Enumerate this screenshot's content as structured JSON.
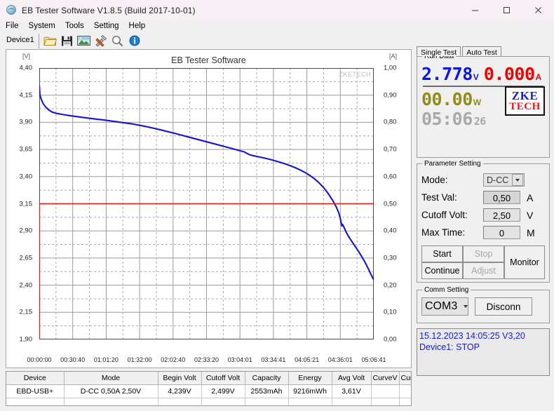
{
  "window": {
    "title": "EB Tester Software V1.8.5 (Build 2017-10-01)",
    "minimize": "–",
    "maximize": "□",
    "close": "✕"
  },
  "menu": [
    "File",
    "System",
    "Tools",
    "Setting",
    "Help"
  ],
  "toolbar": {
    "device_tab": "Device1",
    "icons": [
      "open-folder-icon",
      "save-disk-icon",
      "image-export-icon",
      "tools-icon",
      "zoom-search-icon",
      "info-icon"
    ]
  },
  "chart_data": {
    "type": "line",
    "title": "EB Tester Software",
    "watermark": "ZKETECH",
    "xlabel": "",
    "ylabel": "[V]",
    "y2label": "[A]",
    "grid": true,
    "legend": "none",
    "ylim": [
      1.9,
      4.4
    ],
    "y2lim": [
      0.0,
      1.0
    ],
    "yticks": [
      "4,40",
      "4,15",
      "3,90",
      "3,65",
      "3,40",
      "3,15",
      "2,90",
      "2,65",
      "2,40",
      "2,15",
      "1,90"
    ],
    "y2ticks": [
      "1,00",
      "0,90",
      "0,80",
      "0,70",
      "0,60",
      "0,50",
      "0,40",
      "0,30",
      "0,20",
      "0,10",
      "0,00"
    ],
    "xticks": [
      "00:00:00",
      "00:30:40",
      "01:01:20",
      "01:32:00",
      "02:02:40",
      "02:33:20",
      "03:04:01",
      "03:34:41",
      "04:05:21",
      "04:36:01",
      "05:06:41"
    ],
    "xlim_seconds": [
      0,
      18401
    ],
    "series": [
      {
        "name": "Voltage",
        "unit": "V",
        "color": "#1414d2",
        "axis": "left",
        "points": [
          [
            0,
            4.239
          ],
          [
            0.3,
            4.15
          ],
          [
            0.8,
            4.115
          ],
          [
            1.6,
            4.075
          ],
          [
            2.6,
            4.045
          ],
          [
            4.0,
            4.015
          ],
          [
            5.5,
            3.995
          ],
          [
            7.5,
            3.982
          ],
          [
            10.0,
            3.972
          ],
          [
            13.0,
            3.962
          ],
          [
            16.0,
            3.953
          ],
          [
            19.0,
            3.944
          ],
          [
            22.0,
            3.936
          ],
          [
            25.0,
            3.928
          ],
          [
            28.0,
            3.921
          ],
          [
            31.0,
            3.912
          ],
          [
            34.0,
            3.903
          ],
          [
            37.0,
            3.894
          ],
          [
            40.0,
            3.885
          ],
          [
            43.0,
            3.873
          ],
          [
            46.0,
            3.86
          ],
          [
            49.0,
            3.846
          ],
          [
            52.0,
            3.831
          ],
          [
            55.0,
            3.815
          ],
          [
            58.0,
            3.799
          ],
          [
            61.0,
            3.782
          ],
          [
            64.0,
            3.765
          ],
          [
            67.0,
            3.748
          ],
          [
            70.0,
            3.731
          ],
          [
            73.0,
            3.714
          ],
          [
            76.0,
            3.697
          ],
          [
            79.0,
            3.68
          ],
          [
            82.0,
            3.663
          ],
          [
            85.0,
            3.645
          ],
          [
            88.0,
            3.628
          ],
          [
            89.5,
            3.61
          ],
          [
            90.5,
            3.6
          ],
          [
            92.0,
            3.592
          ],
          [
            94.0,
            3.583
          ],
          [
            96.0,
            3.574
          ],
          [
            98.0,
            3.564
          ],
          [
            100.0,
            3.553
          ],
          [
            102.0,
            3.541
          ],
          [
            104.0,
            3.528
          ],
          [
            106.0,
            3.514
          ],
          [
            108.0,
            3.498
          ],
          [
            110.0,
            3.481
          ],
          [
            112.0,
            3.461
          ],
          [
            114.0,
            3.439
          ],
          [
            116.0,
            3.413
          ],
          [
            118.0,
            3.382
          ],
          [
            120.0,
            3.345
          ],
          [
            122.0,
            3.3
          ],
          [
            124.0,
            3.245
          ],
          [
            126.0,
            3.18
          ],
          [
            127.5,
            3.12
          ],
          [
            128.5,
            3.07
          ],
          [
            129.2,
            3.02
          ],
          [
            129.6,
            2.975
          ],
          [
            129.9,
            2.945
          ],
          [
            130.2,
            2.96
          ],
          [
            130.8,
            2.935
          ],
          [
            131.6,
            2.895
          ],
          [
            132.6,
            2.855
          ],
          [
            133.8,
            2.815
          ],
          [
            135.2,
            2.77
          ],
          [
            136.8,
            2.72
          ],
          [
            138.4,
            2.665
          ],
          [
            140.0,
            2.605
          ],
          [
            141.4,
            2.545
          ],
          [
            142.6,
            2.49
          ],
          [
            143.6,
            2.449
          ]
        ]
      },
      {
        "name": "Current",
        "unit": "A",
        "color": "#ee1111",
        "axis": "right",
        "points": [
          [
            0,
            0.0
          ],
          [
            0,
            0.5
          ],
          [
            143.6,
            0.5
          ],
          [
            143.6,
            0.5
          ]
        ]
      }
    ]
  },
  "results_table": {
    "headers": [
      "Device",
      "Mode",
      "Begin Volt",
      "Cutoff Volt",
      "Capacity",
      "Energy",
      "Avg Volt",
      "CurveV",
      "CurveA"
    ],
    "rows": [
      {
        "device": "EBD-USB+",
        "mode": "D-CC 0,50A 2,50V",
        "begin_volt": "4,239V",
        "cutoff_volt": "2,499V",
        "capacity": "2553mAh",
        "energy": "9216mWh",
        "avg_volt": "3,61V",
        "curve_v_color": "#0000ee",
        "curve_a_color": "#ee0000"
      }
    ]
  },
  "right_panel": {
    "tabs": [
      {
        "label": "Single Test",
        "active": true
      },
      {
        "label": "Auto Test",
        "active": false
      }
    ],
    "run_data": {
      "title": "Run Data",
      "voltage": "2.778",
      "voltage_unit": "V",
      "current": "0.000",
      "current_unit": "A",
      "power": "00.00",
      "power_unit": "W",
      "time": "05:06",
      "time_seconds": "26",
      "logo_top": "ZKE",
      "logo_bottom": "TECH"
    },
    "parameter_setting": {
      "title": "Parameter Setting",
      "mode_label": "Mode:",
      "mode_value": "D-CC",
      "test_val_label": "Test Val:",
      "test_val_value": "0,50",
      "test_val_unit": "A",
      "cutoff_volt_label": "Cutoff Volt:",
      "cutoff_volt_value": "2,50",
      "cutoff_volt_unit": "V",
      "max_time_label": "Max Time:",
      "max_time_value": "0",
      "max_time_unit": "M",
      "start_button": "Start",
      "stop_button": "Stop",
      "continue_button": "Continue",
      "adjust_button": "Adjust",
      "monitor_button": "Monitor"
    },
    "comm_setting": {
      "title": "Comm Setting",
      "port_value": "COM3",
      "disconnect_button": "Disconn"
    },
    "log": [
      "15.12.2023 14:05:25  V3,20",
      "Device1: STOP"
    ]
  }
}
